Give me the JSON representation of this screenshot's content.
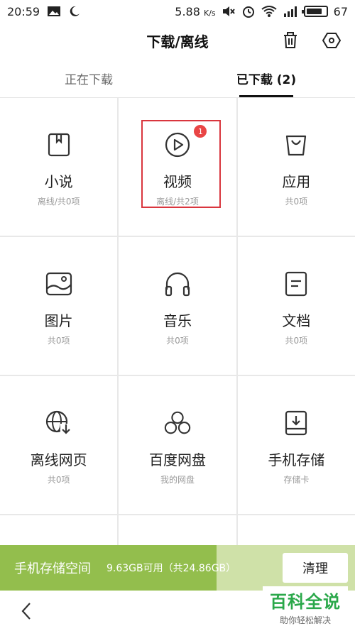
{
  "status_bar": {
    "time": "20:59",
    "speed": "5.88",
    "speed_unit": "K/s",
    "battery": "67"
  },
  "header": {
    "title": "下载/离线"
  },
  "tabs": [
    {
      "label": "正在下载"
    },
    {
      "label": "已下载 (2)"
    }
  ],
  "grid": [
    {
      "title": "小说",
      "sub": "离线/共0项",
      "icon": "book-icon"
    },
    {
      "title": "视频",
      "sub": "离线/共2项",
      "icon": "play-icon",
      "badge": "1"
    },
    {
      "title": "应用",
      "sub": "共0项",
      "icon": "bag-icon"
    },
    {
      "title": "图片",
      "sub": "共0项",
      "icon": "image-icon"
    },
    {
      "title": "音乐",
      "sub": "共0项",
      "icon": "headphones-icon"
    },
    {
      "title": "文档",
      "sub": "共0项",
      "icon": "document-icon"
    },
    {
      "title": "离线网页",
      "sub": "共0项",
      "icon": "globe-download-icon"
    },
    {
      "title": "百度网盘",
      "sub": "我的网盘",
      "icon": "cloud-circles-icon"
    },
    {
      "title": "手机存储",
      "sub": "存储卡",
      "icon": "storage-download-icon"
    }
  ],
  "storage": {
    "label": "手机存储空间",
    "info": "9.63GB可用（共24.86GB）",
    "used_fraction": 0.61,
    "clean_label": "清理"
  },
  "watermark": {
    "main": "百科全说",
    "sub": "助你轻松解决"
  },
  "colors": {
    "accent_green": "#93be4d",
    "highlight_red": "#d9363e",
    "watermark_green": "#2aa84a"
  }
}
